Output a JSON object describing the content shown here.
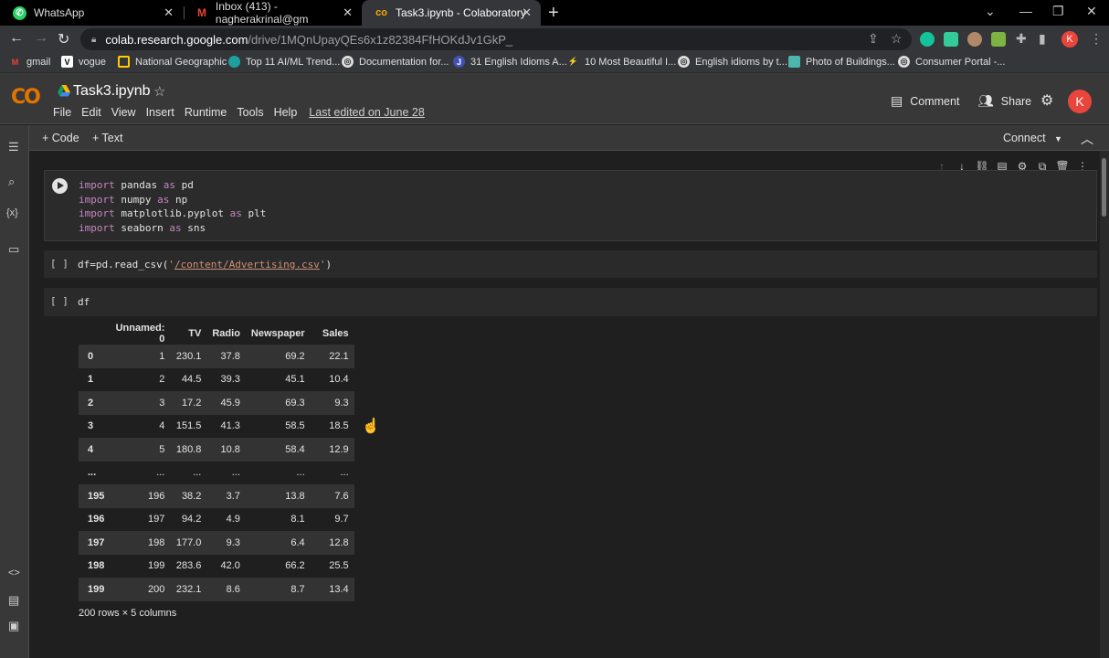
{
  "browser": {
    "tabs": [
      {
        "title": "WhatsApp",
        "icon": "whatsapp-icon"
      },
      {
        "title": "Inbox (413) - nagherakrinal@gm",
        "icon": "gmail-icon"
      },
      {
        "title": "Task3.ipynb - Colaboratory",
        "icon": "colab-icon",
        "active": true
      }
    ],
    "url_host": "colab.research.google.com",
    "url_path": "/drive/1MQnUpayQEs6x1z82384FfHOKdJv1GkP_",
    "profile_initial": "K",
    "bookmarks": [
      {
        "label": "gmail",
        "icon": "gmail-icon"
      },
      {
        "label": "vogue",
        "icon": "vogue-icon"
      },
      {
        "label": "National Geographic",
        "icon": "natgeo-icon"
      },
      {
        "label": "Top 11 AI/ML Trend...",
        "icon": "bookmark-icon"
      },
      {
        "label": "Documentation for...",
        "icon": "globe-icon"
      },
      {
        "label": "31 English Idioms A...",
        "icon": "bookmark-icon"
      },
      {
        "label": "10 Most Beautiful I...",
        "icon": "bookmark-icon"
      },
      {
        "label": "English idioms by t...",
        "icon": "globe-icon"
      },
      {
        "label": "Photo of Buildings...",
        "icon": "bookmark-icon"
      },
      {
        "label": "Consumer Portal -...",
        "icon": "globe-icon"
      }
    ]
  },
  "colab": {
    "logo": "CO",
    "notebook_title": "Task3.ipynb",
    "menu": [
      "File",
      "Edit",
      "View",
      "Insert",
      "Runtime",
      "Tools",
      "Help"
    ],
    "last_edited": "Last edited on June 28",
    "comment_label": "Comment",
    "share_label": "Share",
    "profile_initial": "K",
    "toolbar": {
      "add_code": "+ Code",
      "add_text": "+ Text",
      "connect": "Connect"
    }
  },
  "cells": [
    {
      "type": "code",
      "lines": [
        {
          "kw1": "import",
          "mod": " pandas ",
          "kw2": "as",
          "alias": " pd"
        },
        {
          "kw1": "import",
          "mod": " numpy ",
          "kw2": "as",
          "alias": " np"
        },
        {
          "kw1": "import",
          "mod": " matplotlib.pyplot ",
          "kw2": "as",
          "alias": " plt"
        },
        {
          "kw1": "import",
          "mod": " seaborn ",
          "kw2": "as",
          "alias": " sns"
        }
      ]
    },
    {
      "type": "code",
      "bracket": "[ ]",
      "prefix": "df=pd.read_csv(",
      "quote_open": "'",
      "string": "/content/Advertising.csv",
      "quote_close": "'",
      "suffix": ")"
    },
    {
      "type": "code",
      "bracket": "[ ]",
      "code": "df"
    }
  ],
  "dataframe": {
    "columns": [
      "Unnamed: 0",
      "TV",
      "Radio",
      "Newspaper",
      "Sales"
    ],
    "rows": [
      [
        "0",
        "1",
        "230.1",
        "37.8",
        "69.2",
        "22.1"
      ],
      [
        "1",
        "2",
        "44.5",
        "39.3",
        "45.1",
        "10.4"
      ],
      [
        "2",
        "3",
        "17.2",
        "45.9",
        "69.3",
        "9.3"
      ],
      [
        "3",
        "4",
        "151.5",
        "41.3",
        "58.5",
        "18.5"
      ],
      [
        "4",
        "5",
        "180.8",
        "10.8",
        "58.4",
        "12.9"
      ],
      [
        "...",
        "...",
        "...",
        "...",
        "...",
        "..."
      ],
      [
        "195",
        "196",
        "38.2",
        "3.7",
        "13.8",
        "7.6"
      ],
      [
        "196",
        "197",
        "94.2",
        "4.9",
        "8.1",
        "9.7"
      ],
      [
        "197",
        "198",
        "177.0",
        "9.3",
        "6.4",
        "12.8"
      ],
      [
        "198",
        "199",
        "283.6",
        "42.0",
        "66.2",
        "25.5"
      ],
      [
        "199",
        "200",
        "232.1",
        "8.6",
        "8.7",
        "13.4"
      ]
    ],
    "shape": "200 rows × 5 columns"
  }
}
